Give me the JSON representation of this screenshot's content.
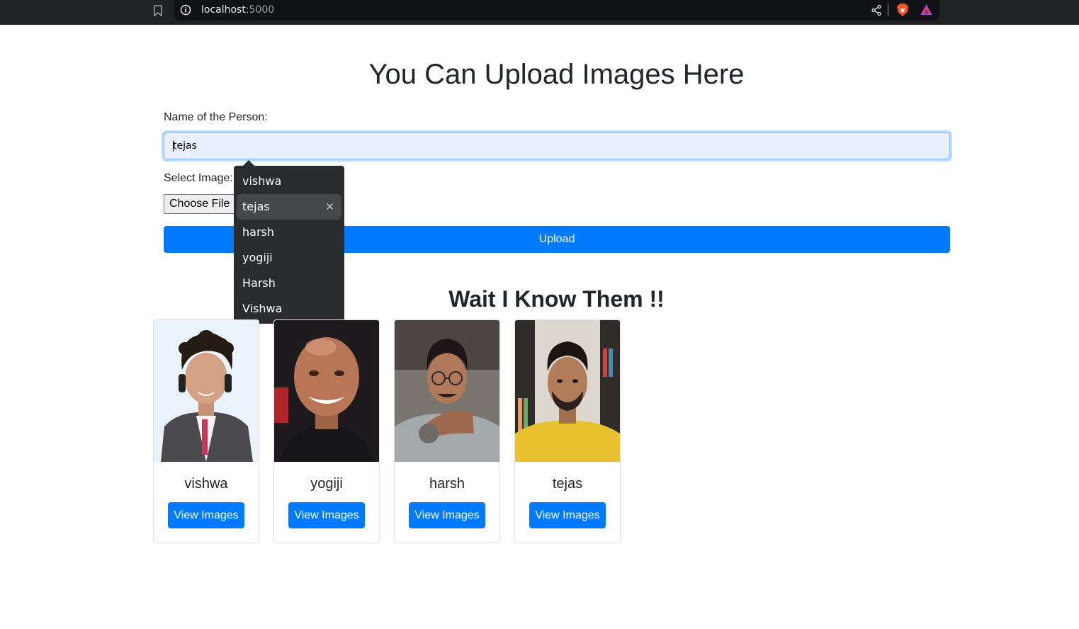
{
  "browser": {
    "url_host": "localhost",
    "url_port": ":5000"
  },
  "page": {
    "title": "You Can Upload Images Here",
    "name_label": "Name of the Person:",
    "name_value": "tejas",
    "image_label": "Select Image:",
    "file_button": "Choose File",
    "upload_button": "Upload",
    "section_title": "Wait I Know Them !!"
  },
  "autocomplete": {
    "items": [
      "vishwa",
      "tejas",
      "harsh",
      "yogiji",
      "Harsh",
      "Vishwa"
    ],
    "selected": "tejas"
  },
  "people": [
    {
      "name": "vishwa",
      "button": "View Images"
    },
    {
      "name": "yogiji",
      "button": "View Images"
    },
    {
      "name": "harsh",
      "button": "View Images"
    },
    {
      "name": "tejas",
      "button": "View Images"
    }
  ],
  "colors": {
    "primary": "#007bff",
    "browser_bg": "#202124",
    "dropdown_bg": "#2b2c2f"
  }
}
